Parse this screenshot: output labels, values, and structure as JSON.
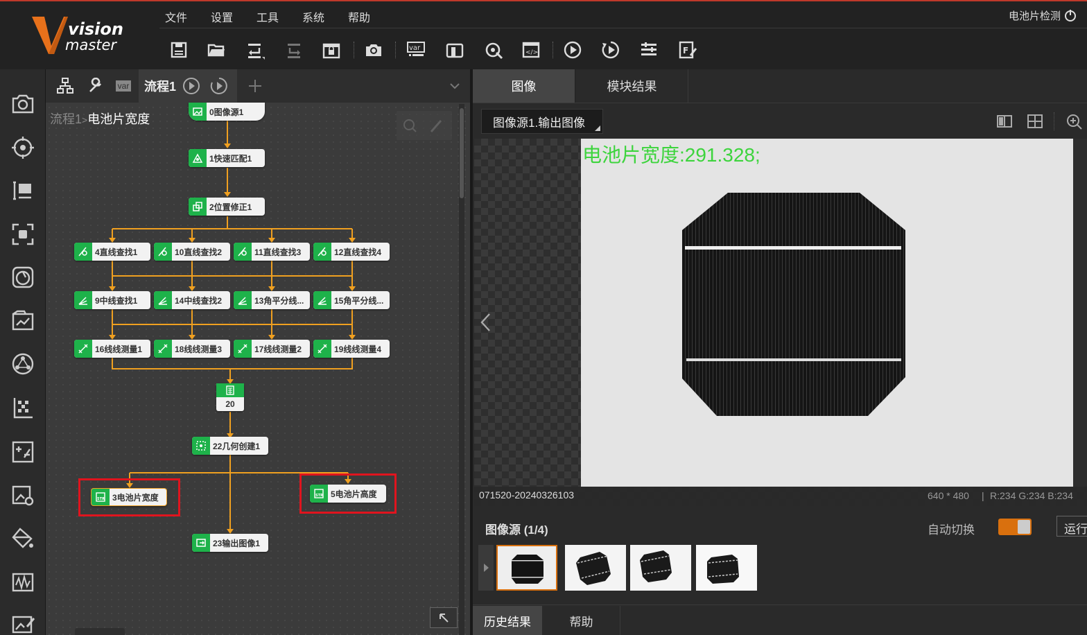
{
  "menu": {
    "file": "文件",
    "settings": "设置",
    "tools": "工具",
    "system": "系统",
    "help": "帮助"
  },
  "app_name": "电池片检测",
  "logo": {
    "line1": "vision",
    "line2": "master"
  },
  "flow": {
    "tab_label": "流程1",
    "var_label": "var",
    "breadcrumb_parent": "流程1",
    "breadcrumb_sep": ">",
    "breadcrumb_current": "电池片宽度",
    "nodes": {
      "n0": "0图像源1",
      "n1": "1快速匹配1",
      "n2": "2位置修正1",
      "n4": "4直线查找1",
      "n10": "10直线查找2",
      "n11": "11直线查找3",
      "n12": "12直线查找4",
      "n9": "9中线查找1",
      "n14": "14中线查找2",
      "n13": "13角平分线...",
      "n15": "15角平分线...",
      "n16": "16线线测量1",
      "n18": "18线线测量3",
      "n17": "17线线测量2",
      "n19": "19线线测量4",
      "n20": "20",
      "n22": "22几何创建1",
      "n3": "3电池片宽度",
      "n5": "5电池片高度",
      "n23": "23输出图像1"
    }
  },
  "right": {
    "tab_image": "图像",
    "tab_module": "模块结果",
    "image_select": "图像源1.输出图像",
    "overlay_text": "电池片宽度:291.328;",
    "status_left": "071520-20240326103",
    "status_size": "640 * 480",
    "status_sep": "|",
    "status_rgb": "R:234  G:234  B:234",
    "source_label": "图像源 (1/4)",
    "auto_switch": "自动切换",
    "auto_switch_on": true,
    "run_button": "运行",
    "history_tab": "历史结果",
    "help_tab": "帮助"
  },
  "colors": {
    "accent_green": "#1eb24a",
    "flow_line": "#f0a020",
    "highlight_red": "#e0141e",
    "toggle_orange": "#d9700e",
    "overlay_green": "#3dd43d"
  }
}
